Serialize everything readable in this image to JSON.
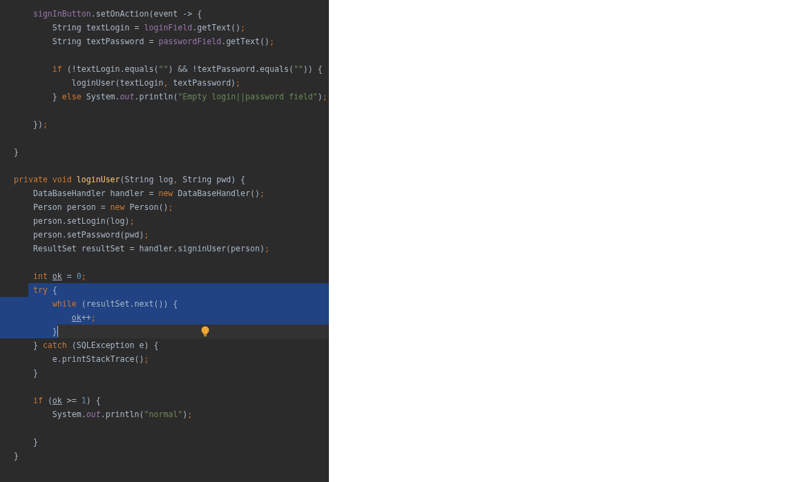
{
  "editor": {
    "intention_bulb": true,
    "lines": [
      {
        "kind": "code",
        "selected": false,
        "current": false,
        "tokens": [
          {
            "text": "    signInButton",
            "kind": "field"
          },
          {
            "text": ".setOnAction(event -> {",
            "kind": "plain"
          }
        ]
      },
      {
        "kind": "code",
        "selected": false,
        "current": false,
        "tokens": [
          {
            "text": "        String textLogin = ",
            "kind": "plain"
          },
          {
            "text": "loginField",
            "kind": "field"
          },
          {
            "text": ".getText()",
            "kind": "plain"
          },
          {
            "text": ";",
            "kind": "keyword"
          }
        ]
      },
      {
        "kind": "code",
        "selected": false,
        "current": false,
        "tokens": [
          {
            "text": "        String textPassword = ",
            "kind": "plain"
          },
          {
            "text": "passwordField",
            "kind": "field"
          },
          {
            "text": ".getText()",
            "kind": "plain"
          },
          {
            "text": ";",
            "kind": "keyword"
          }
        ]
      },
      {
        "kind": "blank",
        "selected": false,
        "current": false
      },
      {
        "kind": "code",
        "selected": false,
        "current": false,
        "tokens": [
          {
            "text": "        if",
            "kind": "keyword"
          },
          {
            "text": " (!textLogin.equals(",
            "kind": "plain"
          },
          {
            "text": "\"\"",
            "kind": "string"
          },
          {
            "text": ") && !textPassword.equals(",
            "kind": "plain"
          },
          {
            "text": "\"\"",
            "kind": "string"
          },
          {
            "text": ")) {",
            "kind": "plain"
          }
        ]
      },
      {
        "kind": "code",
        "selected": false,
        "current": false,
        "tokens": [
          {
            "text": "            loginUser(textLogin",
            "kind": "plain"
          },
          {
            "text": ",",
            "kind": "keyword"
          },
          {
            "text": " textPassword)",
            "kind": "plain"
          },
          {
            "text": ";",
            "kind": "keyword"
          }
        ]
      },
      {
        "kind": "code",
        "selected": false,
        "current": false,
        "tokens": [
          {
            "text": "        } ",
            "kind": "plain"
          },
          {
            "text": "else",
            "kind": "keyword"
          },
          {
            "text": " System.",
            "kind": "plain"
          },
          {
            "text": "out",
            "kind": "static"
          },
          {
            "text": ".println(",
            "kind": "plain"
          },
          {
            "text": "\"Empty login||password field\"",
            "kind": "string"
          },
          {
            "text": ")",
            "kind": "plain"
          },
          {
            "text": ";",
            "kind": "keyword"
          }
        ]
      },
      {
        "kind": "blank",
        "selected": false,
        "current": false
      },
      {
        "kind": "code",
        "selected": false,
        "current": false,
        "tokens": [
          {
            "text": "    })",
            "kind": "plain"
          },
          {
            "text": ";",
            "kind": "keyword"
          }
        ]
      },
      {
        "kind": "blank",
        "selected": false,
        "current": false
      },
      {
        "kind": "code",
        "selected": false,
        "current": false,
        "tokens": [
          {
            "text": "}",
            "kind": "plain"
          }
        ]
      },
      {
        "kind": "blank",
        "selected": false,
        "current": false
      },
      {
        "kind": "code",
        "selected": false,
        "current": false,
        "tokens": [
          {
            "text": "private void ",
            "kind": "keyword"
          },
          {
            "text": "loginUser",
            "kind": "method"
          },
          {
            "text": "(String log",
            "kind": "plain"
          },
          {
            "text": ",",
            "kind": "keyword"
          },
          {
            "text": " String pwd) {",
            "kind": "plain"
          }
        ]
      },
      {
        "kind": "code",
        "selected": false,
        "current": false,
        "tokens": [
          {
            "text": "    DataBaseHandler handler = ",
            "kind": "plain"
          },
          {
            "text": "new",
            "kind": "keyword"
          },
          {
            "text": " DataBaseHandler()",
            "kind": "plain"
          },
          {
            "text": ";",
            "kind": "keyword"
          }
        ]
      },
      {
        "kind": "code",
        "selected": false,
        "current": false,
        "tokens": [
          {
            "text": "    Person person = ",
            "kind": "plain"
          },
          {
            "text": "new",
            "kind": "keyword"
          },
          {
            "text": " Person()",
            "kind": "plain"
          },
          {
            "text": ";",
            "kind": "keyword"
          }
        ]
      },
      {
        "kind": "code",
        "selected": false,
        "current": false,
        "tokens": [
          {
            "text": "    person.setLogin(log)",
            "kind": "plain"
          },
          {
            "text": ";",
            "kind": "keyword"
          }
        ]
      },
      {
        "kind": "code",
        "selected": false,
        "current": false,
        "tokens": [
          {
            "text": "    person.setPassword(pwd)",
            "kind": "plain"
          },
          {
            "text": ";",
            "kind": "keyword"
          }
        ]
      },
      {
        "kind": "code",
        "selected": false,
        "current": false,
        "tokens": [
          {
            "text": "    ResultSet resultSet = handler.signinUser(person)",
            "kind": "plain"
          },
          {
            "text": ";",
            "kind": "keyword"
          }
        ]
      },
      {
        "kind": "blank",
        "selected": false,
        "current": false
      },
      {
        "kind": "code",
        "selected": false,
        "current": false,
        "tokens": [
          {
            "text": "    int ",
            "kind": "keyword"
          },
          {
            "text": "ok",
            "kind": "variable"
          },
          {
            "text": " = ",
            "kind": "plain"
          },
          {
            "text": "0",
            "kind": "number"
          },
          {
            "text": ";",
            "kind": "keyword"
          }
        ]
      },
      {
        "kind": "code",
        "selected": true,
        "current": false,
        "tokens": [
          {
            "text": "    try",
            "kind": "keyword"
          },
          {
            "text": " {",
            "kind": "plain"
          }
        ]
      },
      {
        "kind": "code",
        "selected": true,
        "current": false,
        "tokens": [
          {
            "text": "        while",
            "kind": "keyword"
          },
          {
            "text": " (resultSet.next()) {",
            "kind": "plain"
          }
        ]
      },
      {
        "kind": "code",
        "selected": true,
        "current": false,
        "tokens": [
          {
            "text": "            ok",
            "kind": "variable"
          },
          {
            "text": "++",
            "kind": "plain"
          },
          {
            "text": ";",
            "kind": "keyword"
          }
        ]
      },
      {
        "kind": "code",
        "selected": true,
        "current": true,
        "tokens": [
          {
            "text": "        }",
            "kind": "plain"
          }
        ]
      },
      {
        "kind": "code",
        "selected": false,
        "current": false,
        "tokens": [
          {
            "text": "    } ",
            "kind": "plain"
          },
          {
            "text": "catch",
            "kind": "keyword"
          },
          {
            "text": " (SQLException e) {",
            "kind": "plain"
          }
        ]
      },
      {
        "kind": "code",
        "selected": false,
        "current": false,
        "tokens": [
          {
            "text": "        e.printStackTrace()",
            "kind": "plain"
          },
          {
            "text": ";",
            "kind": "keyword"
          }
        ]
      },
      {
        "kind": "code",
        "selected": false,
        "current": false,
        "tokens": [
          {
            "text": "    }",
            "kind": "plain"
          }
        ]
      },
      {
        "kind": "blank",
        "selected": false,
        "current": false
      },
      {
        "kind": "code",
        "selected": false,
        "current": false,
        "tokens": [
          {
            "text": "    if",
            "kind": "keyword"
          },
          {
            "text": " (",
            "kind": "plain"
          },
          {
            "text": "ok",
            "kind": "variable"
          },
          {
            "text": " >= ",
            "kind": "plain"
          },
          {
            "text": "1",
            "kind": "number"
          },
          {
            "text": ") {",
            "kind": "plain"
          }
        ]
      },
      {
        "kind": "code",
        "selected": false,
        "current": false,
        "tokens": [
          {
            "text": "        System.",
            "kind": "plain"
          },
          {
            "text": "out",
            "kind": "static"
          },
          {
            "text": ".println(",
            "kind": "plain"
          },
          {
            "text": "\"normal\"",
            "kind": "string"
          },
          {
            "text": ")",
            "kind": "plain"
          },
          {
            "text": ";",
            "kind": "keyword"
          }
        ]
      },
      {
        "kind": "blank",
        "selected": false,
        "current": false
      },
      {
        "kind": "code",
        "selected": false,
        "current": false,
        "tokens": [
          {
            "text": "    }",
            "kind": "plain"
          }
        ]
      },
      {
        "kind": "code",
        "selected": false,
        "current": false,
        "tokens": [
          {
            "text": "}",
            "kind": "plain"
          }
        ]
      }
    ]
  }
}
